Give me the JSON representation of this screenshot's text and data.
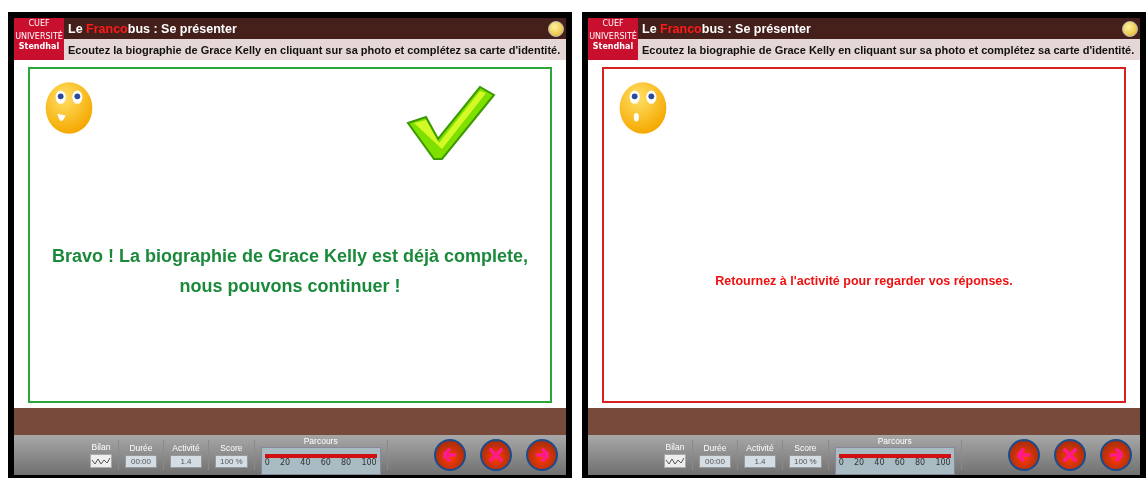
{
  "panels": [
    {
      "logo": {
        "top": "CUEF",
        "middle": "UNIVERSITÉ",
        "name": "Stendhal"
      },
      "title": {
        "prefix": "Le ",
        "highlight": "Franco",
        "suffix": "bus : Se présenter"
      },
      "instruction": "Ecoutez la biographie de Grace Kelly en cliquant sur sa photo et complétez sa carte d'identité.",
      "kind": "success",
      "show_check": true,
      "message": [
        "Bravo ! La biographie de  Grace Kelly est déjà complete,",
        "nous pouvons continuer !"
      ],
      "toolbar": {
        "bilan": "Bilan",
        "duree_label": "Durée",
        "duree": "00:00",
        "activite_label": "Activité",
        "activite": "1.4",
        "score_label": "Score",
        "score": "100 %",
        "parcours_label": "Parcours",
        "level": 1.0,
        "ticks": [
          "0",
          "20",
          "40",
          "60",
          "80",
          "100"
        ]
      }
    },
    {
      "logo": {
        "top": "CUEF",
        "middle": "UNIVERSITÉ",
        "name": "Stendhal"
      },
      "title": {
        "prefix": "Le ",
        "highlight": "Franco",
        "suffix": "bus : Se présenter"
      },
      "instruction": "Ecoutez la biographie de Grace Kelly en cliquant sur sa photo et complétez sa carte d'identité.",
      "kind": "error",
      "show_check": false,
      "message": [
        "Retournez à l'activité pour regarder vos réponses."
      ],
      "toolbar": {
        "bilan": "Bilan",
        "duree_label": "Durée",
        "duree": "00:00",
        "activite_label": "Activité",
        "activite": "1.4",
        "score_label": "Score",
        "score": "100 %",
        "parcours_label": "Parcours",
        "level": 1.0,
        "ticks": [
          "0",
          "20",
          "40",
          "60",
          "80",
          "100"
        ]
      }
    }
  ]
}
